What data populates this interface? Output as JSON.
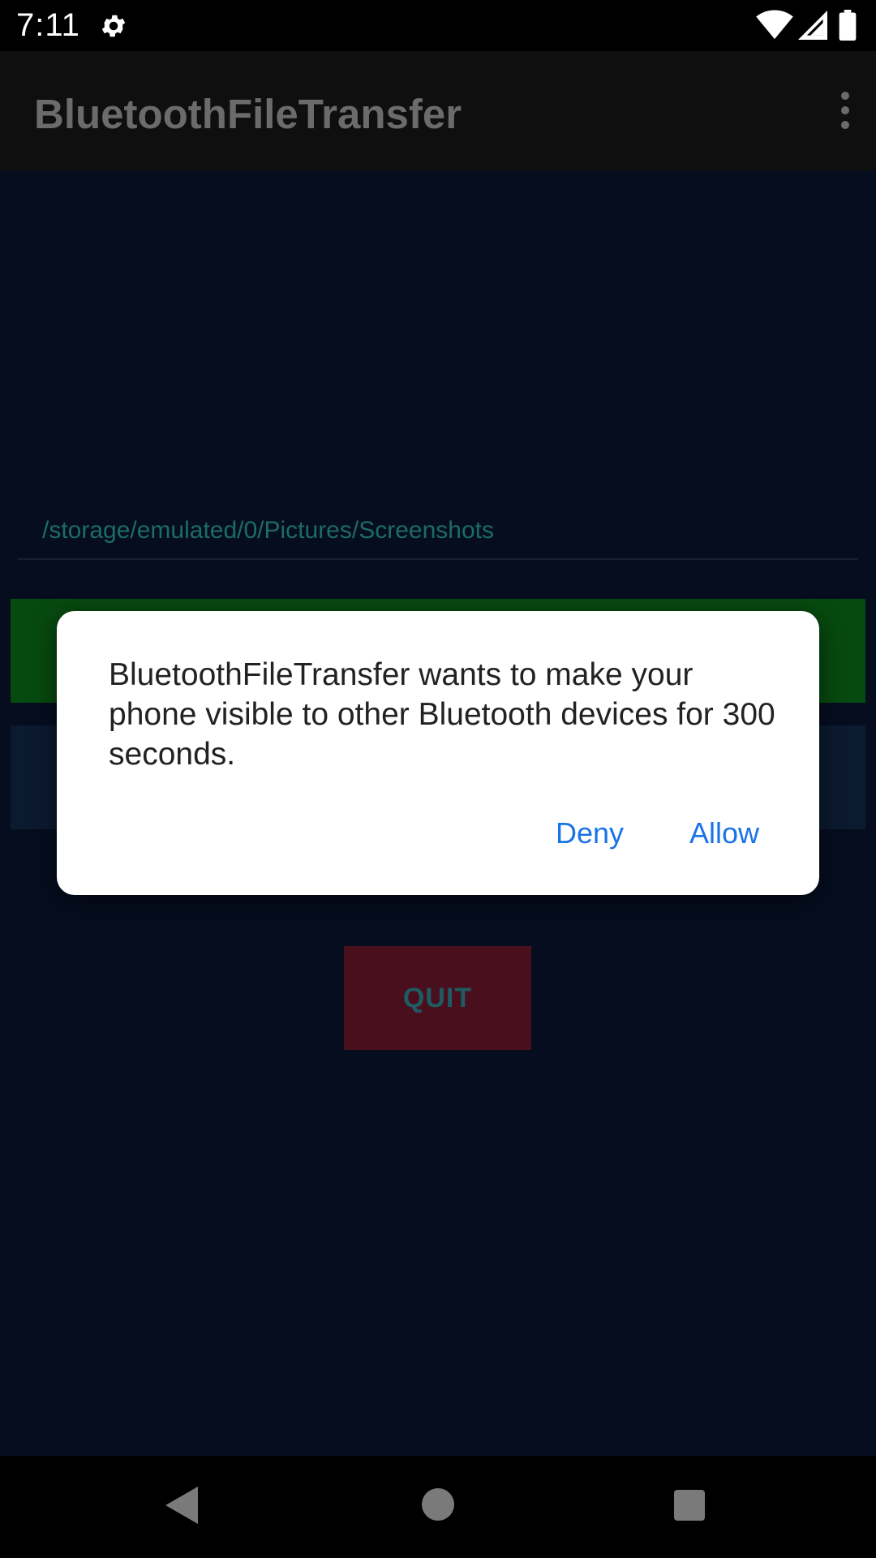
{
  "status_bar": {
    "time": "7:11",
    "icons": [
      "settings-gear-icon",
      "wifi-icon",
      "cell-signal-icon",
      "battery-icon"
    ]
  },
  "app_bar": {
    "title": "BluetoothFileTransfer",
    "menu_icon": "overflow-menu-icon"
  },
  "main": {
    "file_path": "/storage/emulated/0/Pictures/Screenshots",
    "quit_label": "QUIT"
  },
  "dialog": {
    "message": "BluetoothFileTransfer wants to make your phone visible to other Bluetooth devices for 300 seconds.",
    "deny_label": "Deny",
    "allow_label": "Allow"
  },
  "nav_bar": {
    "icons": [
      "back-icon",
      "home-icon",
      "recents-icon"
    ]
  },
  "colors": {
    "background": "#050d1f",
    "green_button": "#074a0f",
    "quit_button": "#4a0f1c",
    "dialog_accent": "#1a73e8"
  }
}
